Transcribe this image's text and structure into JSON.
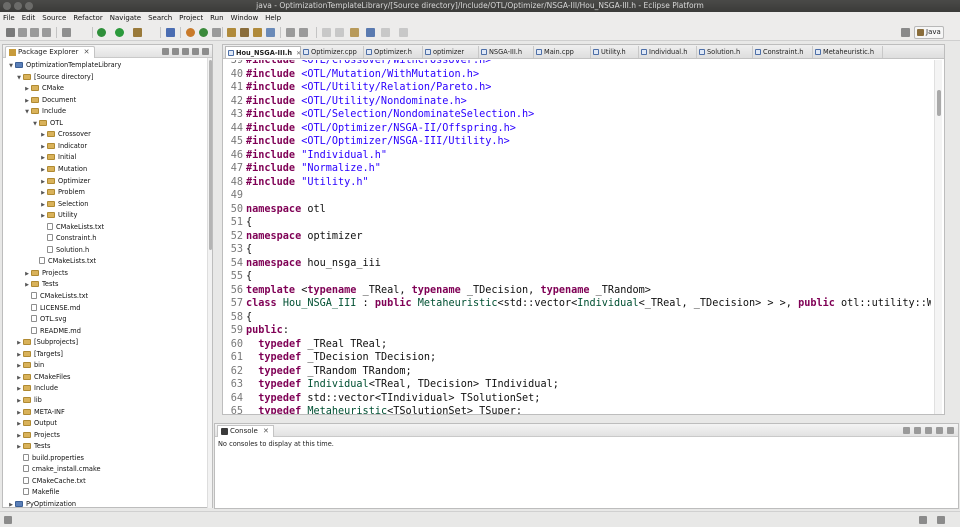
{
  "window": {
    "title": "java - OptimizationTemplateLibrary/[Source directory]/Include/OTL/Optimizer/NSGA-III/Hou_NSGA-III.h - Eclipse Platform"
  },
  "menu": [
    "File",
    "Edit",
    "Source",
    "Refactor",
    "Navigate",
    "Search",
    "Project",
    "Run",
    "Window",
    "Help"
  ],
  "perspective": {
    "label": "Java"
  },
  "explorer": {
    "title": "Package Explorer",
    "close": "✕",
    "items": [
      {
        "label": "OptimizationTemplateLibrary",
        "icon": "project-icon",
        "expanded": true
      },
      {
        "label": "[Source directory]",
        "icon": "folder-icon",
        "expanded": true
      },
      {
        "label": "CMake",
        "icon": "folder-icon",
        "expanded": false
      },
      {
        "label": "Document",
        "icon": "folder-icon",
        "expanded": false
      },
      {
        "label": "Include",
        "icon": "folder-icon",
        "expanded": true
      },
      {
        "label": "OTL",
        "icon": "folder-icon",
        "expanded": true
      },
      {
        "label": "Crossover",
        "icon": "folder-icon",
        "expanded": false
      },
      {
        "label": "Indicator",
        "icon": "folder-icon",
        "expanded": false
      },
      {
        "label": "Initial",
        "icon": "folder-icon",
        "expanded": false
      },
      {
        "label": "Mutation",
        "icon": "folder-icon",
        "expanded": false
      },
      {
        "label": "Optimizer",
        "icon": "folder-icon",
        "expanded": false
      },
      {
        "label": "Problem",
        "icon": "folder-icon",
        "expanded": false
      },
      {
        "label": "Selection",
        "icon": "folder-icon",
        "expanded": false
      },
      {
        "label": "Utility",
        "icon": "folder-icon",
        "expanded": false
      },
      {
        "label": "CMakeLists.txt",
        "icon": "file-icon"
      },
      {
        "label": "Constraint.h",
        "icon": "file-icon"
      },
      {
        "label": "Solution.h",
        "icon": "file-icon"
      },
      {
        "label": "CMakeLists.txt",
        "icon": "file-icon"
      },
      {
        "label": "Projects",
        "icon": "folder-icon",
        "expanded": false
      },
      {
        "label": "Tests",
        "icon": "folder-icon",
        "expanded": false
      },
      {
        "label": "CMakeLists.txt",
        "icon": "file-icon"
      },
      {
        "label": "LICENSE.md",
        "icon": "file-icon"
      },
      {
        "label": "OTL.svg",
        "icon": "file-icon"
      },
      {
        "label": "README.md",
        "icon": "file-icon"
      },
      {
        "label": "[Subprojects]",
        "icon": "folder-icon",
        "expanded": false
      },
      {
        "label": "[Targets]",
        "icon": "folder-icon",
        "expanded": false
      },
      {
        "label": "bin",
        "icon": "folder-icon",
        "expanded": false
      },
      {
        "label": "CMakeFiles",
        "icon": "folder-icon",
        "expanded": false
      },
      {
        "label": "Include",
        "icon": "folder-icon",
        "expanded": false
      },
      {
        "label": "lib",
        "icon": "folder-icon",
        "expanded": false
      },
      {
        "label": "META-INF",
        "icon": "folder-icon",
        "expanded": false
      },
      {
        "label": "Output",
        "icon": "folder-icon",
        "expanded": false
      },
      {
        "label": "Projects",
        "icon": "folder-icon",
        "expanded": false
      },
      {
        "label": "Tests",
        "icon": "folder-icon",
        "expanded": false
      },
      {
        "label": "build.properties",
        "icon": "file-icon"
      },
      {
        "label": "cmake_install.cmake",
        "icon": "file-icon"
      },
      {
        "label": "CMakeCache.txt",
        "icon": "file-icon"
      },
      {
        "label": "Makefile",
        "icon": "file-icon"
      },
      {
        "label": "PyOptimization",
        "icon": "project-icon",
        "expanded": false
      }
    ]
  },
  "editor": {
    "tabs": [
      {
        "label": "Hou_NSGA-III.h",
        "active": true,
        "close": "✕"
      },
      {
        "label": "Optimizer.cpp"
      },
      {
        "label": "Optimizer.h"
      },
      {
        "label": "optimizer"
      },
      {
        "label": "NSGA-III.h"
      },
      {
        "label": "Main.cpp"
      },
      {
        "label": "Utility.h"
      },
      {
        "label": "Individual.h"
      },
      {
        "label": "Solution.h"
      },
      {
        "label": "Constraint.h"
      },
      {
        "label": "Metaheuristic.h"
      }
    ],
    "lines": [
      {
        "n": "39",
        "segs": [
          [
            "kw",
            "#include "
          ],
          [
            "str",
            "<OTL/Crossover/WithCrossover.h>"
          ]
        ]
      },
      {
        "n": "40",
        "segs": [
          [
            "kw",
            "#include "
          ],
          [
            "str",
            "<OTL/Mutation/WithMutation.h>"
          ]
        ]
      },
      {
        "n": "41",
        "segs": [
          [
            "kw",
            "#include "
          ],
          [
            "str",
            "<OTL/Utility/Relation/Pareto.h>"
          ]
        ]
      },
      {
        "n": "42",
        "segs": [
          [
            "kw",
            "#include "
          ],
          [
            "str",
            "<OTL/Utility/Nondominate.h>"
          ]
        ]
      },
      {
        "n": "43",
        "segs": [
          [
            "kw",
            "#include "
          ],
          [
            "str",
            "<OTL/Selection/NondominateSelection.h>"
          ]
        ]
      },
      {
        "n": "44",
        "segs": [
          [
            "kw",
            "#include "
          ],
          [
            "str",
            "<OTL/Optimizer/NSGA-II/Offspring.h>"
          ]
        ]
      },
      {
        "n": "45",
        "segs": [
          [
            "kw",
            "#include "
          ],
          [
            "str",
            "<OTL/Optimizer/NSGA-III/Utility.h>"
          ]
        ]
      },
      {
        "n": "46",
        "segs": [
          [
            "kw",
            "#include "
          ],
          [
            "str",
            "\"Individual.h\""
          ]
        ]
      },
      {
        "n": "47",
        "segs": [
          [
            "kw",
            "#include "
          ],
          [
            "str",
            "\"Normalize.h\""
          ]
        ]
      },
      {
        "n": "48",
        "segs": [
          [
            "kw",
            "#include "
          ],
          [
            "str",
            "\"Utility.h\""
          ]
        ]
      },
      {
        "n": "49",
        "segs": []
      },
      {
        "n": "50",
        "segs": [
          [
            "kw",
            "namespace"
          ],
          [
            "pl",
            " otl"
          ]
        ]
      },
      {
        "n": "51",
        "segs": [
          [
            "pl",
            "{"
          ]
        ]
      },
      {
        "n": "52",
        "segs": [
          [
            "kw",
            "namespace"
          ],
          [
            "pl",
            " optimizer"
          ]
        ]
      },
      {
        "n": "53",
        "segs": [
          [
            "pl",
            "{"
          ]
        ]
      },
      {
        "n": "54",
        "segs": [
          [
            "kw",
            "namespace"
          ],
          [
            "pl",
            " hou_nsga_iii"
          ]
        ]
      },
      {
        "n": "55",
        "segs": [
          [
            "pl",
            "{"
          ]
        ]
      },
      {
        "n": "56",
        "segs": [
          [
            "kw",
            "template"
          ],
          [
            "pl",
            " <"
          ],
          [
            "kw",
            "typename"
          ],
          [
            "pl",
            " _TReal, "
          ],
          [
            "kw",
            "typename"
          ],
          [
            "pl",
            " _TDecision, "
          ],
          [
            "kw",
            "typename"
          ],
          [
            "pl",
            " _TRandom>"
          ]
        ]
      },
      {
        "n": "57",
        "segs": [
          [
            "kw",
            "class"
          ],
          [
            "pl",
            " "
          ],
          [
            "ty",
            "Hou_NSGA_III"
          ],
          [
            "pl",
            " : "
          ],
          [
            "kw",
            "public"
          ],
          [
            "pl",
            " "
          ],
          [
            "ty",
            "Metaheuristic"
          ],
          [
            "pl",
            "<std::vector<"
          ],
          [
            "ty",
            "Individual"
          ],
          [
            "pl",
            "<_TReal, _TDecision> > >, "
          ],
          [
            "kw",
            "public"
          ],
          [
            "pl",
            " otl::utility::Wit"
          ]
        ]
      },
      {
        "n": "58",
        "segs": [
          [
            "pl",
            "{"
          ]
        ]
      },
      {
        "n": "59",
        "segs": [
          [
            "kw",
            "public"
          ],
          [
            "pl",
            ":"
          ]
        ]
      },
      {
        "n": "60",
        "segs": [
          [
            "pl",
            "  "
          ],
          [
            "kw",
            "typedef"
          ],
          [
            "pl",
            " _TReal TReal;"
          ]
        ]
      },
      {
        "n": "61",
        "segs": [
          [
            "pl",
            "  "
          ],
          [
            "kw",
            "typedef"
          ],
          [
            "pl",
            " _TDecision TDecision;"
          ]
        ]
      },
      {
        "n": "62",
        "segs": [
          [
            "pl",
            "  "
          ],
          [
            "kw",
            "typedef"
          ],
          [
            "pl",
            " _TRandom TRandom;"
          ]
        ]
      },
      {
        "n": "63",
        "segs": [
          [
            "pl",
            "  "
          ],
          [
            "kw",
            "typedef"
          ],
          [
            "pl",
            " "
          ],
          [
            "ty",
            "Individual"
          ],
          [
            "pl",
            "<TReal, TDecision> TIndividual;"
          ]
        ]
      },
      {
        "n": "64",
        "segs": [
          [
            "pl",
            "  "
          ],
          [
            "kw",
            "typedef"
          ],
          [
            "pl",
            " std::vector<TIndividual> TSolutionSet;"
          ]
        ]
      },
      {
        "n": "65",
        "segs": [
          [
            "pl",
            "  "
          ],
          [
            "kw",
            "typedef"
          ],
          [
            "pl",
            " "
          ],
          [
            "ty",
            "Metaheuristic"
          ],
          [
            "pl",
            "<TSolutionSet> TSuper;"
          ]
        ]
      }
    ]
  },
  "console": {
    "title": "Console",
    "close": "✕",
    "message": "No consoles to display at this time."
  }
}
